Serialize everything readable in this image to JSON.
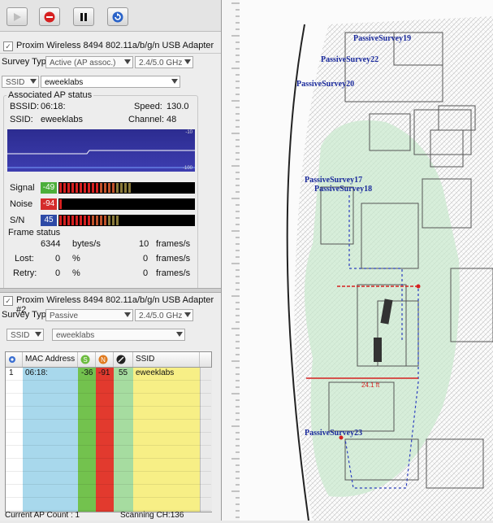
{
  "toolbar": {
    "buttons": [
      "play-icon",
      "stop-icon",
      "pause-icon",
      "refresh-icon"
    ]
  },
  "adapter1": {
    "name": "Proxim Wireless 8494 802.11a/b/g/n USB Adapter",
    "survey_type_label": "Survey Type",
    "survey_type_value": "Active (AP assoc.)",
    "band_value": "2.4/5.0 GHz",
    "filter_field": "SSID",
    "filter_value": "eweeklabs",
    "ap_status": {
      "title": "Associated AP status",
      "bssid_label": "BSSID:",
      "bssid_value": "06:18:",
      "speed_label": "Speed:",
      "speed_value": "130.0",
      "ssid_label": "SSID:",
      "ssid_value": "eweeklabs",
      "channel_label": "Channel:",
      "channel_value": "48"
    },
    "graph": {
      "top_label": "-10",
      "bottom_label": "-100"
    },
    "meters": [
      {
        "label": "Signal",
        "value": "-49",
        "color": "#4caf3a",
        "fill_fraction": 0.55
      },
      {
        "label": "Noise",
        "value": "-94",
        "color": "#d42b2b",
        "fill_fraction": 0.03
      },
      {
        "label": "S/N",
        "value": "45",
        "color": "#2d4aa6",
        "fill_fraction": 0.44
      }
    ],
    "frame_status": {
      "title": "Frame status",
      "bytes_value": "6344",
      "bytes_unit": "bytes/s",
      "frames_value": "10",
      "frames_unit": "frames/s",
      "lost_label": "Lost:",
      "lost_value": "0",
      "lost_pct": "%",
      "lost_frames": "0",
      "lost_unit": "frames/s",
      "retry_label": "Retry:",
      "retry_value": "0",
      "retry_pct": "%",
      "retry_frames": "0",
      "retry_unit": "frames/s"
    }
  },
  "adapter2": {
    "name": "Proxim Wireless 8494 802.11a/b/g/n USB Adapter #2",
    "survey_type_label": "Survey Type",
    "survey_type_value": "Passive",
    "band_value": "2.4/5.0 GHz",
    "filter_field": "SSID",
    "filter_value": "eweeklabs",
    "table": {
      "headers": {
        "num": "#",
        "mac": "MAC Address",
        "s": "S",
        "n": "N",
        "sn": "",
        "ssid": "SSID"
      },
      "rows": [
        {
          "num": "1",
          "mac": "06:18:",
          "s": "-36",
          "n": "-91",
          "sn": "55",
          "ssid": "eweeklabs"
        }
      ]
    }
  },
  "status": {
    "ap_count": "Current AP Count : 1",
    "scanning": "Scanning CH:136"
  },
  "map": {
    "labels": [
      "PassiveSurvey19",
      "PassiveSurvey22",
      "PassiveSurvey20",
      "PassiveSurvey17",
      "PassiveSurvey18",
      "PassiveSurvey23"
    ],
    "dimension": "24.1 ft"
  }
}
